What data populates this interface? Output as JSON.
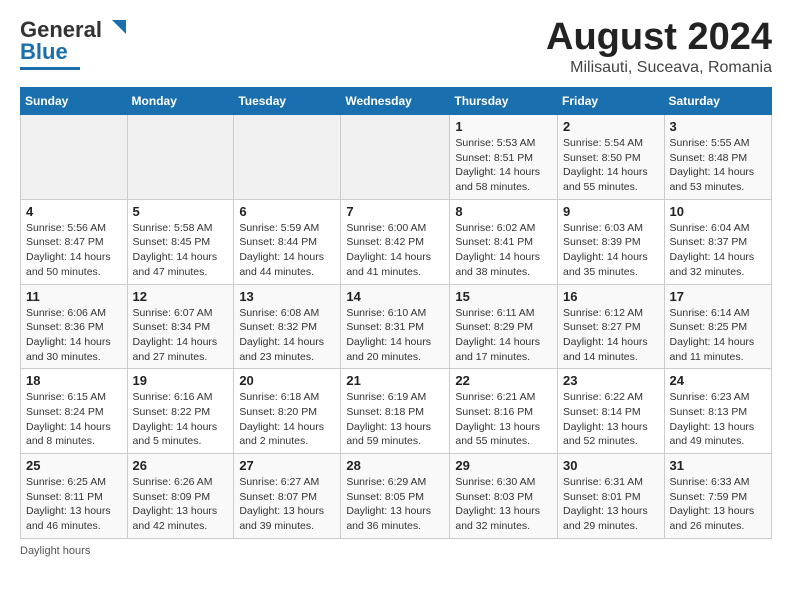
{
  "logo": {
    "text1": "General",
    "text2": "Blue"
  },
  "title": {
    "month_year": "August 2024",
    "location": "Milisauti, Suceava, Romania"
  },
  "days_of_week": [
    "Sunday",
    "Monday",
    "Tuesday",
    "Wednesday",
    "Thursday",
    "Friday",
    "Saturday"
  ],
  "weeks": [
    [
      {
        "num": "",
        "info": ""
      },
      {
        "num": "",
        "info": ""
      },
      {
        "num": "",
        "info": ""
      },
      {
        "num": "",
        "info": ""
      },
      {
        "num": "1",
        "info": "Sunrise: 5:53 AM\nSunset: 8:51 PM\nDaylight: 14 hours\nand 58 minutes."
      },
      {
        "num": "2",
        "info": "Sunrise: 5:54 AM\nSunset: 8:50 PM\nDaylight: 14 hours\nand 55 minutes."
      },
      {
        "num": "3",
        "info": "Sunrise: 5:55 AM\nSunset: 8:48 PM\nDaylight: 14 hours\nand 53 minutes."
      }
    ],
    [
      {
        "num": "4",
        "info": "Sunrise: 5:56 AM\nSunset: 8:47 PM\nDaylight: 14 hours\nand 50 minutes."
      },
      {
        "num": "5",
        "info": "Sunrise: 5:58 AM\nSunset: 8:45 PM\nDaylight: 14 hours\nand 47 minutes."
      },
      {
        "num": "6",
        "info": "Sunrise: 5:59 AM\nSunset: 8:44 PM\nDaylight: 14 hours\nand 44 minutes."
      },
      {
        "num": "7",
        "info": "Sunrise: 6:00 AM\nSunset: 8:42 PM\nDaylight: 14 hours\nand 41 minutes."
      },
      {
        "num": "8",
        "info": "Sunrise: 6:02 AM\nSunset: 8:41 PM\nDaylight: 14 hours\nand 38 minutes."
      },
      {
        "num": "9",
        "info": "Sunrise: 6:03 AM\nSunset: 8:39 PM\nDaylight: 14 hours\nand 35 minutes."
      },
      {
        "num": "10",
        "info": "Sunrise: 6:04 AM\nSunset: 8:37 PM\nDaylight: 14 hours\nand 32 minutes."
      }
    ],
    [
      {
        "num": "11",
        "info": "Sunrise: 6:06 AM\nSunset: 8:36 PM\nDaylight: 14 hours\nand 30 minutes."
      },
      {
        "num": "12",
        "info": "Sunrise: 6:07 AM\nSunset: 8:34 PM\nDaylight: 14 hours\nand 27 minutes."
      },
      {
        "num": "13",
        "info": "Sunrise: 6:08 AM\nSunset: 8:32 PM\nDaylight: 14 hours\nand 23 minutes."
      },
      {
        "num": "14",
        "info": "Sunrise: 6:10 AM\nSunset: 8:31 PM\nDaylight: 14 hours\nand 20 minutes."
      },
      {
        "num": "15",
        "info": "Sunrise: 6:11 AM\nSunset: 8:29 PM\nDaylight: 14 hours\nand 17 minutes."
      },
      {
        "num": "16",
        "info": "Sunrise: 6:12 AM\nSunset: 8:27 PM\nDaylight: 14 hours\nand 14 minutes."
      },
      {
        "num": "17",
        "info": "Sunrise: 6:14 AM\nSunset: 8:25 PM\nDaylight: 14 hours\nand 11 minutes."
      }
    ],
    [
      {
        "num": "18",
        "info": "Sunrise: 6:15 AM\nSunset: 8:24 PM\nDaylight: 14 hours\nand 8 minutes."
      },
      {
        "num": "19",
        "info": "Sunrise: 6:16 AM\nSunset: 8:22 PM\nDaylight: 14 hours\nand 5 minutes."
      },
      {
        "num": "20",
        "info": "Sunrise: 6:18 AM\nSunset: 8:20 PM\nDaylight: 14 hours\nand 2 minutes."
      },
      {
        "num": "21",
        "info": "Sunrise: 6:19 AM\nSunset: 8:18 PM\nDaylight: 13 hours\nand 59 minutes."
      },
      {
        "num": "22",
        "info": "Sunrise: 6:21 AM\nSunset: 8:16 PM\nDaylight: 13 hours\nand 55 minutes."
      },
      {
        "num": "23",
        "info": "Sunrise: 6:22 AM\nSunset: 8:14 PM\nDaylight: 13 hours\nand 52 minutes."
      },
      {
        "num": "24",
        "info": "Sunrise: 6:23 AM\nSunset: 8:13 PM\nDaylight: 13 hours\nand 49 minutes."
      }
    ],
    [
      {
        "num": "25",
        "info": "Sunrise: 6:25 AM\nSunset: 8:11 PM\nDaylight: 13 hours\nand 46 minutes."
      },
      {
        "num": "26",
        "info": "Sunrise: 6:26 AM\nSunset: 8:09 PM\nDaylight: 13 hours\nand 42 minutes."
      },
      {
        "num": "27",
        "info": "Sunrise: 6:27 AM\nSunset: 8:07 PM\nDaylight: 13 hours\nand 39 minutes."
      },
      {
        "num": "28",
        "info": "Sunrise: 6:29 AM\nSunset: 8:05 PM\nDaylight: 13 hours\nand 36 minutes."
      },
      {
        "num": "29",
        "info": "Sunrise: 6:30 AM\nSunset: 8:03 PM\nDaylight: 13 hours\nand 32 minutes."
      },
      {
        "num": "30",
        "info": "Sunrise: 6:31 AM\nSunset: 8:01 PM\nDaylight: 13 hours\nand 29 minutes."
      },
      {
        "num": "31",
        "info": "Sunrise: 6:33 AM\nSunset: 7:59 PM\nDaylight: 13 hours\nand 26 minutes."
      }
    ]
  ],
  "footer": {
    "daylight_label": "Daylight hours"
  }
}
